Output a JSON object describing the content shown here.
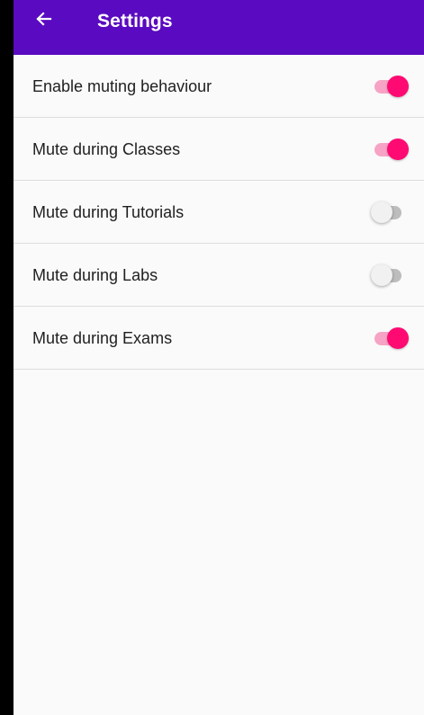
{
  "header": {
    "title": "Settings",
    "back_icon": "arrow-back-icon"
  },
  "settings": {
    "items": [
      {
        "label": "Enable muting behaviour",
        "enabled": true
      },
      {
        "label": "Mute during Classes",
        "enabled": true
      },
      {
        "label": "Mute during Tutorials",
        "enabled": false
      },
      {
        "label": "Mute during Labs",
        "enabled": false
      },
      {
        "label": "Mute during Exams",
        "enabled": true
      }
    ]
  },
  "colors": {
    "app_bar": "#5a0ac0",
    "switch_on_thumb": "#ff0a73",
    "switch_on_track": "#f7a3c5",
    "switch_off_thumb": "#f1f1f1",
    "switch_off_track": "#bdbdbd",
    "background": "#fafafa",
    "divider": "#dddddd"
  }
}
